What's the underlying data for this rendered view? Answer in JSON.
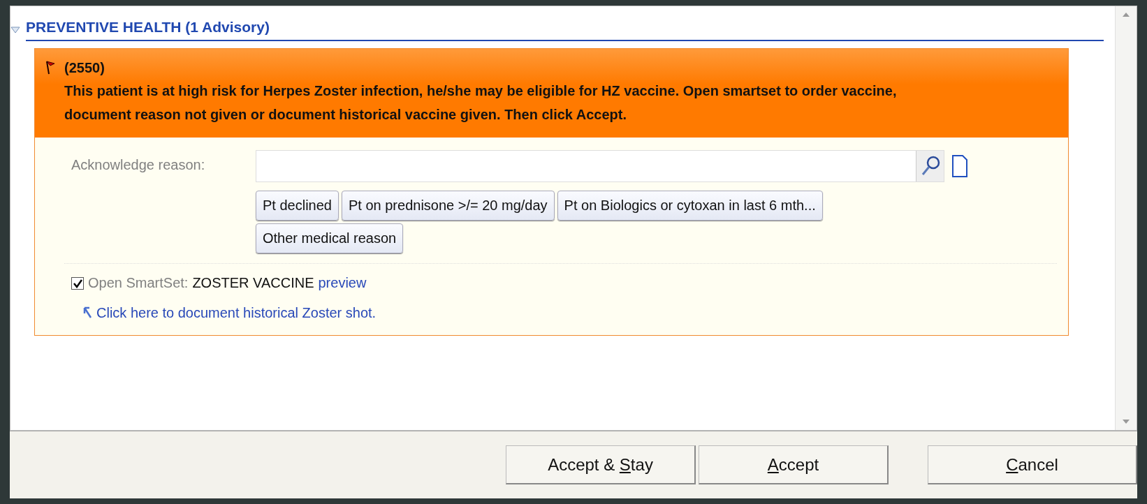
{
  "section": {
    "title": "PREVENTIVE HEALTH (1 Advisory)",
    "expanded": true
  },
  "advisory": {
    "code": "(2550)",
    "message": "This patient is at high risk for Herpes Zoster infection, he/she may be eligible for HZ vaccine. Open smartset to order vaccine, document reason not given or document historical vaccine given. Then click Accept.",
    "acknowledge_label": "Acknowledge reason:",
    "reasons": [
      "Pt declined",
      "Pt on prednisone >/= 20 mg/day",
      "Pt on Biologics or cytoxan in last 6 mth...",
      "Other medical reason"
    ],
    "smartset": {
      "checked": true,
      "label": "Open SmartSet:",
      "name": "ZOSTER VACCINE",
      "link": "preview"
    },
    "history_link": "Click here to document historical Zoster shot."
  },
  "buttons": [
    {
      "before": "Accept & ",
      "key": "S",
      "after": "tay"
    },
    {
      "key": "A",
      "after": "ccept"
    },
    {
      "key": "C",
      "after": "ancel"
    }
  ]
}
